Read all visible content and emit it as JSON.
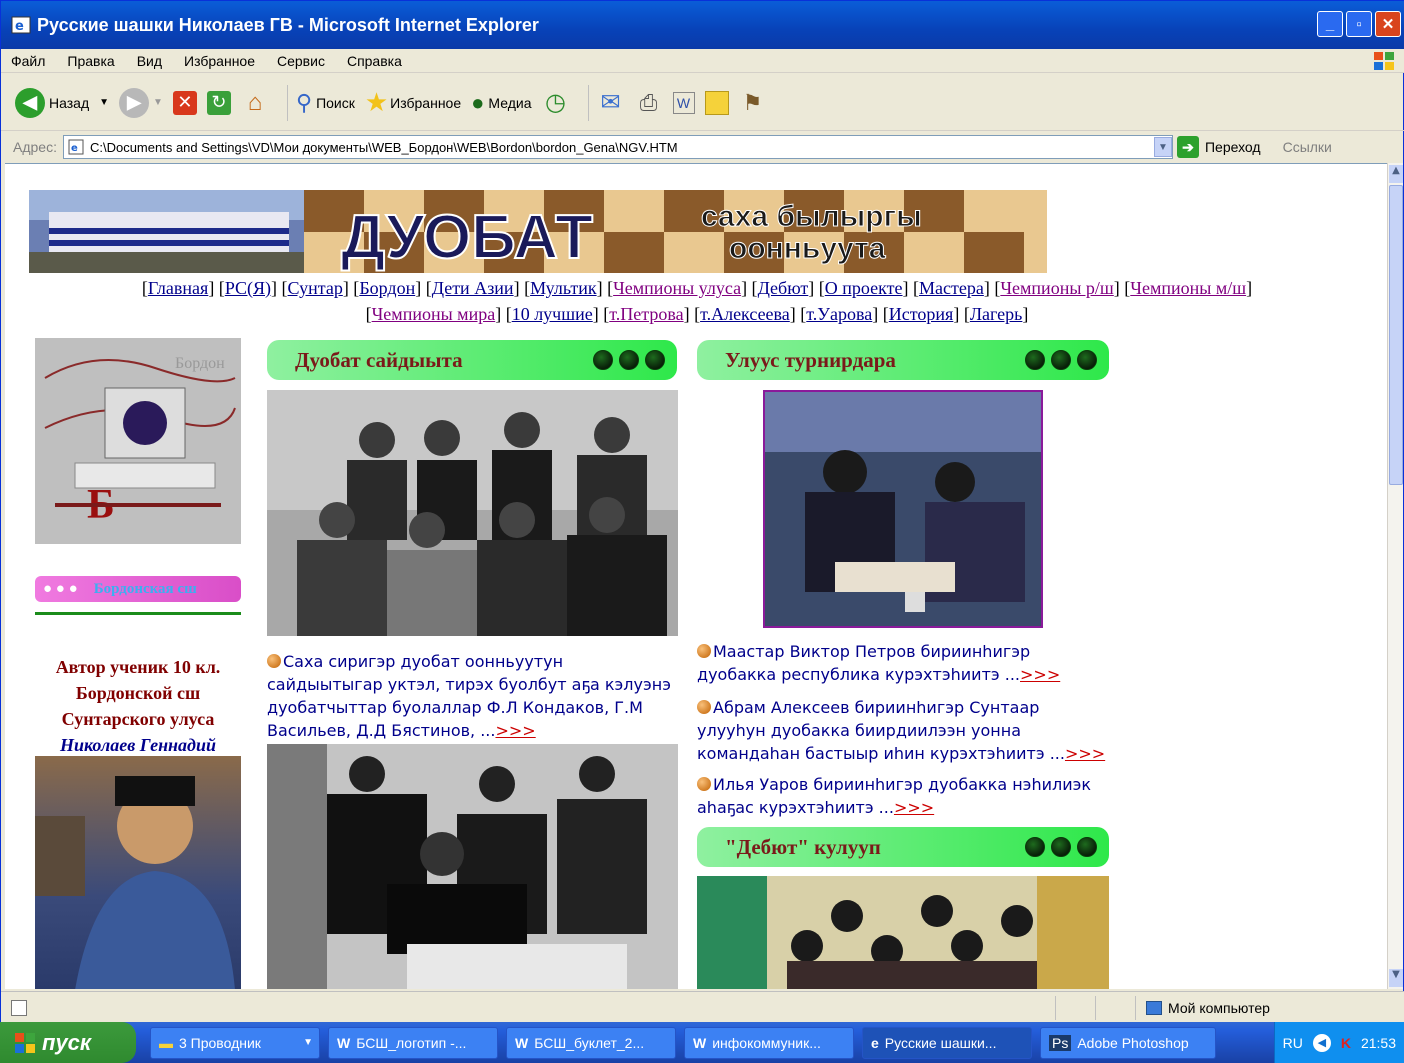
{
  "window": {
    "title": "Русские шашки Николаев ГВ - Microsoft Internet Explorer"
  },
  "menu": [
    "Файл",
    "Правка",
    "Вид",
    "Избранное",
    "Сервис",
    "Справка"
  ],
  "toolbar": {
    "back": "Назад",
    "search": "Поиск",
    "favorites": "Избранное",
    "media": "Медиа"
  },
  "address": {
    "label": "Адрес:",
    "url": "C:\\Documents and Settings\\VD\\Мои документы\\WEB_Бордон\\WEB\\Bordon\\bordon_Gena\\NGV.HTM",
    "go": "Переход",
    "links": "Ссылки"
  },
  "page": {
    "banner": {
      "big": "ДУОБАТ",
      "small1": "саха былыргы",
      "small2": "оонньуута"
    },
    "nav1": [
      "Главная",
      "РС(Я)",
      "Сунтар",
      "Бордон",
      "Дети Азии",
      "Мультик",
      "Чемпионы улуса",
      "Дебют",
      "О проекте",
      "Мастера",
      "Чемпионы р/ш",
      "Чемпионы м/ш"
    ],
    "nav2": [
      "Чемпионы мира",
      "10 лучшие",
      "т.Петрова",
      "т.Алексеева",
      "т.Уарова",
      "История",
      "Лагерь"
    ],
    "left": {
      "logo_letter": "Б",
      "logo_text": "Бордон",
      "school_bar": "Бордонская сш",
      "author_line1": "Автор ученик 10 кл.",
      "author_line2": "Бордонской сш",
      "author_line3": "Сунтарского улуса",
      "author_name": "Николаев Геннадий"
    },
    "col1": {
      "header": "Дуобат сайдыыта",
      "news1": "Саха сиригэр дуобат оонньуутун сайдыытыгар уктэл, тирэх буолбут аҕа кэлуэнэ дуобатчыттар буолаллар Ф.Л Кондаков, Г.М Васильев, Д.Д Бястинов, ...",
      "more": ">>>"
    },
    "col2": {
      "header": "Улуус турнирдара",
      "news": [
        {
          "text": "Маастар Виктор Петров бириинhигэр дуобакка республика курэхтэhиитэ ...",
          "more": ">>>"
        },
        {
          "text": "Абрам Алексеев бириинhигэр Сунтаар улууhун дуобакка биирдиилээн уонна командаhан бастыыр иhин курэхтэhиитэ ...",
          "more": ">>>"
        },
        {
          "text": "Илья Уаров бириинhигэр дуобакка нэhилиэк аhаҕас курэхтэhиитэ ...",
          "more": ">>>"
        }
      ],
      "header2": "\"Дебют\"  кулууп"
    }
  },
  "status": {
    "zone": "Мой компьютер"
  },
  "taskbar": {
    "start": "пуск",
    "tasks": [
      "3 Проводник",
      "БСШ_логотип -...",
      "БСШ_буклет_2...",
      "инфокоммуник...",
      "Русские шашки...",
      "Adobe Photoshop"
    ],
    "lang": "RU",
    "time": "21:53"
  }
}
